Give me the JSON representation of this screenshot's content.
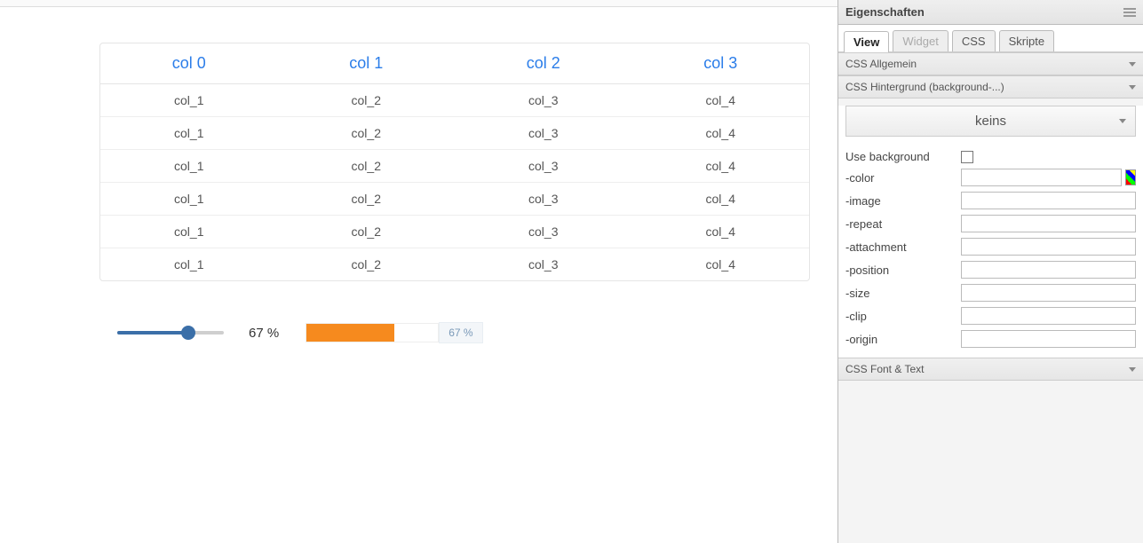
{
  "table": {
    "headers": [
      "col 0",
      "col 1",
      "col 2",
      "col 3"
    ],
    "rows": [
      [
        "col_1",
        "col_2",
        "col_3",
        "col_4"
      ],
      [
        "col_1",
        "col_2",
        "col_3",
        "col_4"
      ],
      [
        "col_1",
        "col_2",
        "col_3",
        "col_4"
      ],
      [
        "col_1",
        "col_2",
        "col_3",
        "col_4"
      ],
      [
        "col_1",
        "col_2",
        "col_3",
        "col_4"
      ],
      [
        "col_1",
        "col_2",
        "col_3",
        "col_4"
      ]
    ]
  },
  "slider": {
    "percent": 67,
    "label": "67 %"
  },
  "progress": {
    "percent": 67,
    "label": "67 %"
  },
  "panel": {
    "title": "Eigenschaften",
    "tabs": {
      "view": "View",
      "widget": "Widget",
      "css": "CSS",
      "skripte": "Skripte"
    },
    "sections": {
      "css_allgemein": "CSS Allgemein",
      "css_hintergrund": "CSS Hintergrund (background-...)",
      "css_font": "CSS Font & Text"
    },
    "bg_select": "keins",
    "props": {
      "use_bg": "Use background",
      "color": "-color",
      "image": "-image",
      "repeat": "-repeat",
      "attachment": "-attachment",
      "position": "-position",
      "size": "-size",
      "clip": "-clip",
      "origin": "-origin"
    }
  }
}
